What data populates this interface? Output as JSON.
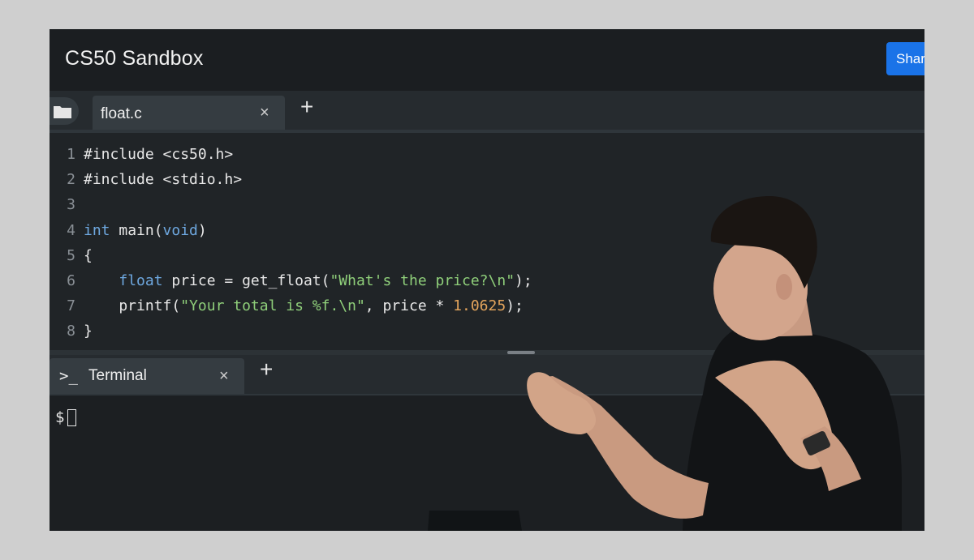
{
  "header": {
    "title": "CS50 Sandbox",
    "share_label": "Share"
  },
  "editor": {
    "tab": {
      "label": "float.c",
      "close": "×"
    },
    "add_tab": "+",
    "lines": [
      {
        "n": "1",
        "parts": [
          [
            "#include <cs50.h>",
            "plain"
          ]
        ]
      },
      {
        "n": "2",
        "parts": [
          [
            "#include <stdio.h>",
            "plain"
          ]
        ]
      },
      {
        "n": "3",
        "parts": []
      },
      {
        "n": "4",
        "parts": [
          [
            "int",
            "kw"
          ],
          [
            " main(",
            "plain"
          ],
          [
            "void",
            "kw"
          ],
          [
            ")",
            "plain"
          ]
        ]
      },
      {
        "n": "5",
        "parts": [
          [
            "{",
            "plain"
          ]
        ]
      },
      {
        "n": "6",
        "parts": [
          [
            "    ",
            "plain"
          ],
          [
            "float",
            "kw"
          ],
          [
            " price = get_float(",
            "plain"
          ],
          [
            "\"What's the price?\\n\"",
            "str"
          ],
          [
            ");",
            "plain"
          ]
        ]
      },
      {
        "n": "7",
        "parts": [
          [
            "    printf(",
            "plain"
          ],
          [
            "\"Your total is %f.\\n\"",
            "str"
          ],
          [
            ", price * ",
            "plain"
          ],
          [
            "1.0625",
            "num"
          ],
          [
            ");",
            "plain"
          ]
        ]
      },
      {
        "n": "8",
        "parts": [
          [
            "}",
            "plain"
          ]
        ]
      }
    ]
  },
  "terminal": {
    "tab": {
      "prefix": ">_",
      "label": "Terminal",
      "close": "×"
    },
    "add_tab": "+",
    "prompt": "$"
  }
}
